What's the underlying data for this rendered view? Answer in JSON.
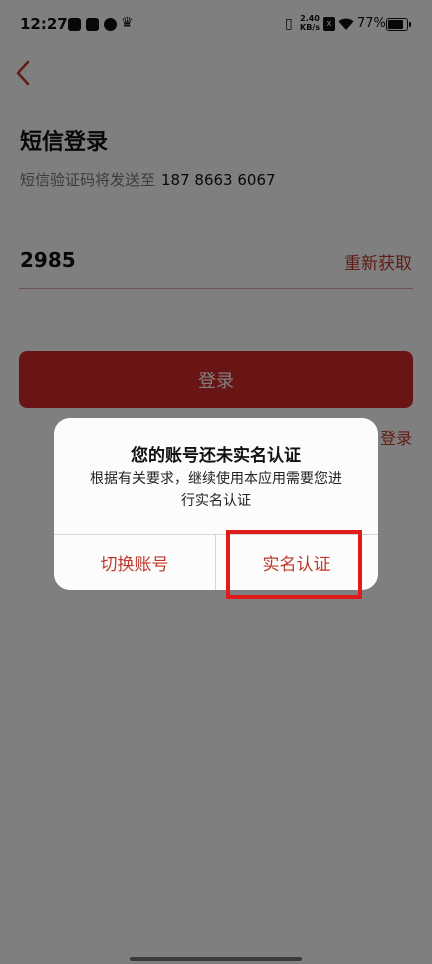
{
  "status_bar": {
    "time": "12:27",
    "net_speed": "2.40\nKB/s",
    "x_badge": "x",
    "battery_pct": "77%",
    "battery_level": 0.77,
    "icons": [
      "tiktok-icon",
      "app-box-icon",
      "link-icon",
      "crown-icon",
      "vibrate-icon",
      "wifi-icon",
      "battery-icon"
    ]
  },
  "header": {
    "title": "短信登录",
    "subtitle": "短信验证码将发送至",
    "phone": "187 8663 6067"
  },
  "code_field": {
    "value": "2985",
    "resend_label": "重新获取"
  },
  "login_button": {
    "label": "登录"
  },
  "other_login": {
    "label": "登录"
  },
  "dialog": {
    "title": "您的账号还未实名认证",
    "message": "根据有关要求，继续使用本应用需要您进行实名认证",
    "left_button": "切换账号",
    "right_button": "实名认证"
  },
  "colors": {
    "accent": "#c0392b",
    "button_bg": "#d32a2a",
    "highlight": "#e01b1b"
  }
}
